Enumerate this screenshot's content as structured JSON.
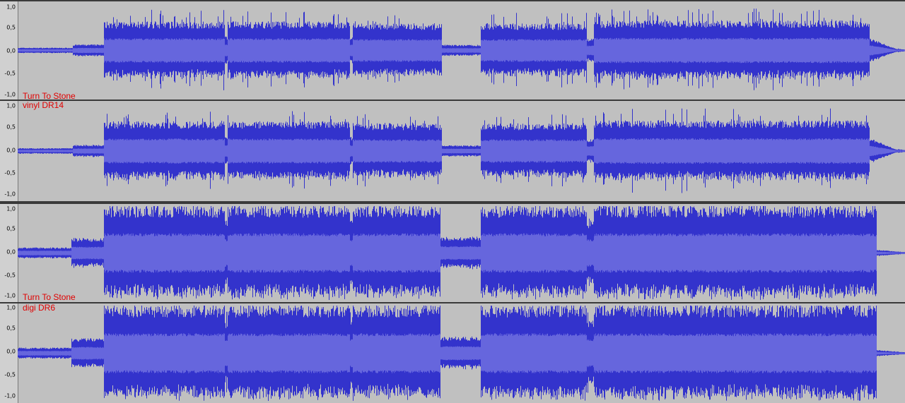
{
  "tracks": [
    {
      "id": "vinyl-left",
      "ticks": [
        "1,0",
        "0,5",
        "0,0",
        "-0,5",
        "-1,0"
      ],
      "label_lines": [
        "Turn To Stone"
      ]
    },
    {
      "id": "vinyl-right",
      "ticks": [
        "1,0",
        "0,5",
        "0,0",
        "-0,5",
        "-1,0"
      ],
      "label_lines": [
        "vinyl DR14"
      ]
    },
    {
      "id": "digi-left",
      "ticks": [
        "1,0",
        "0,5",
        "0,0",
        "-0,5",
        "-1,0"
      ],
      "label_lines": [
        "Turn To Stone"
      ]
    },
    {
      "id": "digi-right",
      "ticks": [
        "1,0",
        "0,5",
        "0,0",
        "-0,5",
        "-1,0"
      ],
      "label_lines": [
        "digi DR6"
      ]
    }
  ],
  "colors": {
    "background": "#c0c0c0",
    "waveform_peak": "#3333cc",
    "waveform_rms": "#6666dd",
    "zero_line": "#3333cc",
    "label_text": "#e00000"
  }
}
